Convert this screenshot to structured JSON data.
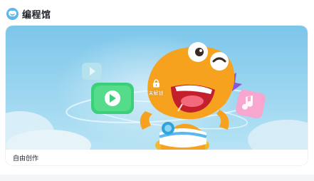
{
  "section": {
    "title": "编程馆",
    "icon": "dino-face-icon"
  },
  "card": {
    "lock_icon": "lock-icon",
    "lock_label": "未解锁",
    "caption": "自由创作"
  },
  "colors": {
    "accent_blue": "#5ab8ee",
    "mascot_orange": "#f6a21e",
    "play_green": "#3ccf7a"
  }
}
